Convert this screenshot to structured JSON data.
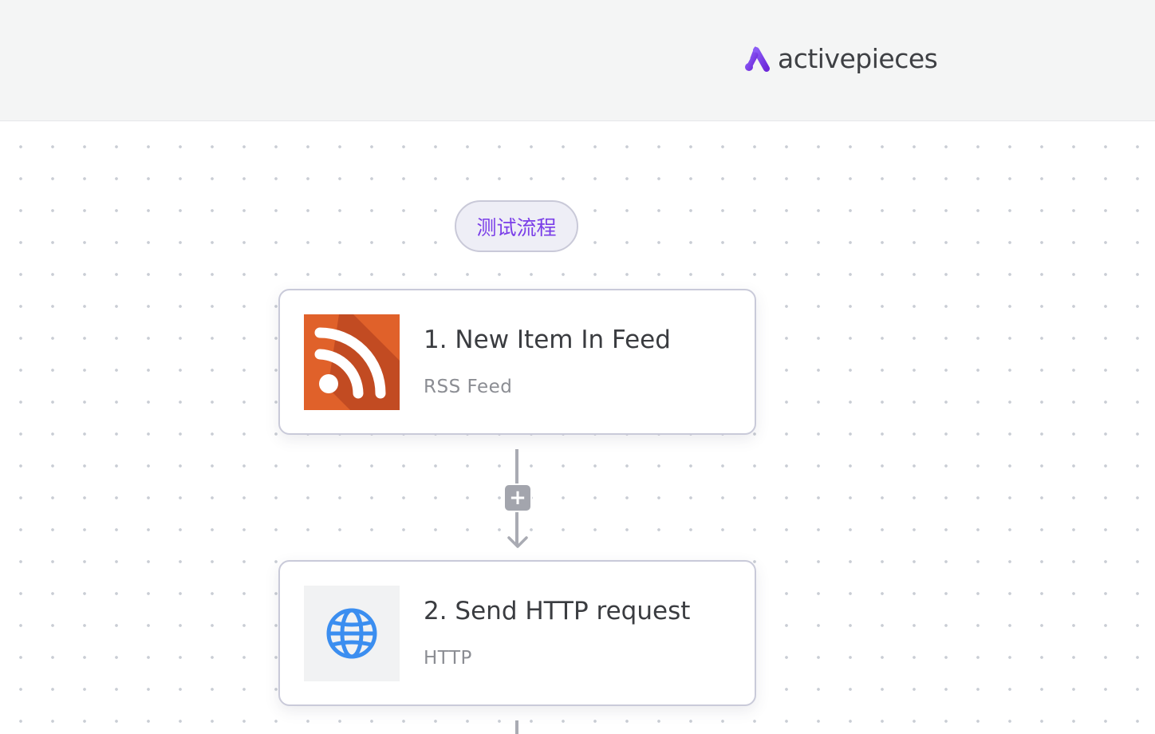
{
  "header": {
    "logo_text": "activepieces",
    "logo_icon": "activepieces-logo-icon",
    "brand_color": "#7a3ee8"
  },
  "flow": {
    "name": "测试流程"
  },
  "steps": [
    {
      "title": "1. New Item In Feed",
      "subtitle": "RSS Feed",
      "icon": "rss-icon",
      "icon_color": "#e0612a"
    },
    {
      "title": "2. Send HTTP request",
      "subtitle": "HTTP",
      "icon": "globe-icon",
      "icon_color": "#3b8ef0"
    }
  ],
  "add_step": {
    "icon": "plus-icon",
    "label": "+"
  }
}
